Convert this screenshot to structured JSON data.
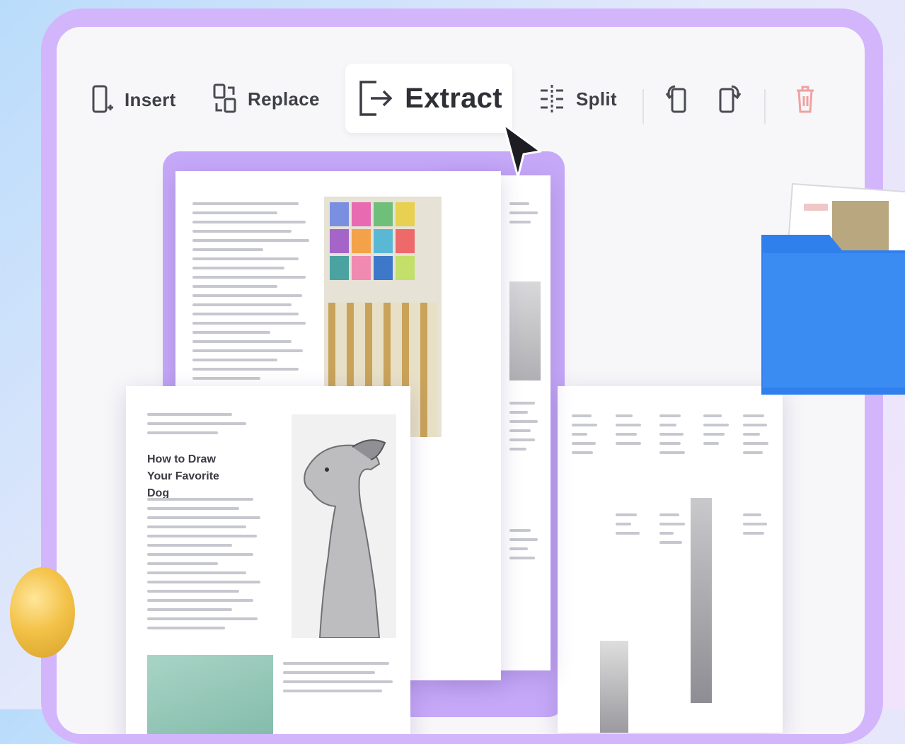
{
  "toolbar": {
    "insert_label": "Insert",
    "replace_label": "Replace",
    "extract_label": "Extract",
    "split_label": "Split"
  },
  "page_front": {
    "article_title": "How to Draw Your Favorite Dog"
  },
  "colors": {
    "frame": "#d3b5fb",
    "panel": "#f7f7f9",
    "folder": "#2f80ed",
    "delete_icon": "#f2a0a0",
    "ball": "#f3c248"
  },
  "icons": [
    "insert-icon",
    "replace-icon",
    "extract-icon",
    "split-icon",
    "rotate-left-icon",
    "rotate-right-icon",
    "trash-icon",
    "cursor-icon",
    "folder-icon"
  ]
}
